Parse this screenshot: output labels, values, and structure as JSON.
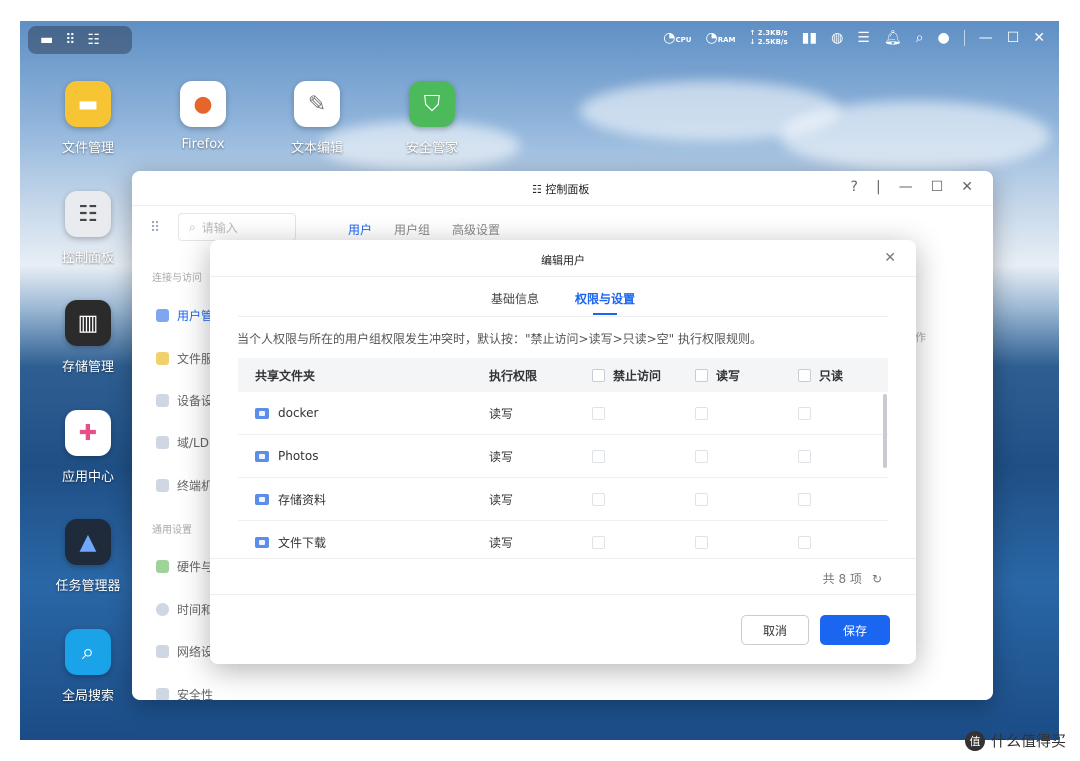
{
  "topbar": {
    "cpu_label": "CPU",
    "ram_label": "RAM",
    "upload": "↑ 2.3KB/s",
    "download": "↓ 2.5KB/s"
  },
  "desktop": {
    "icons": [
      {
        "label": "文件管理"
      },
      {
        "label": "Firefox"
      },
      {
        "label": "文本编辑"
      },
      {
        "label": "安全管家"
      },
      {
        "label": "控制面板"
      },
      {
        "label": "存储管理"
      },
      {
        "label": "应用中心"
      },
      {
        "label": "任务管理器"
      },
      {
        "label": "全局搜索"
      }
    ]
  },
  "control_panel": {
    "title": "控制面板",
    "search_placeholder": "请输入",
    "tabs": [
      "用户",
      "用户组",
      "高级设置"
    ],
    "sidebar": {
      "group1": "连接与访问",
      "group2": "通用设置",
      "items": [
        "用户管",
        "文件服",
        "设备设",
        "域/LD",
        "终端机",
        "硬件与",
        "时间和",
        "网络设",
        "安全性"
      ]
    },
    "right_col": "作"
  },
  "modal": {
    "title": "编辑用户",
    "tabs": [
      "基础信息",
      "权限与设置"
    ],
    "active_tab": 1,
    "note": "当个人权限与所在的用户组权限发生冲突时，默认按：\"禁止访问>读写>只读>空\" 执行权限规则。",
    "headers": {
      "folder": "共享文件夹",
      "effective": "执行权限",
      "deny": "禁止访问",
      "rw": "读写",
      "ro": "只读"
    },
    "rows": [
      {
        "folder": "docker",
        "effective": "读写"
      },
      {
        "folder": "Photos",
        "effective": "读写"
      },
      {
        "folder": "存储资料",
        "effective": "读写"
      },
      {
        "folder": "文件下载",
        "effective": "读写"
      }
    ],
    "count": "共 8 项",
    "cancel_label": "取消",
    "save_label": "保存"
  },
  "watermark": "什么值得买",
  "colors": {
    "accent": "#1a66f0"
  }
}
